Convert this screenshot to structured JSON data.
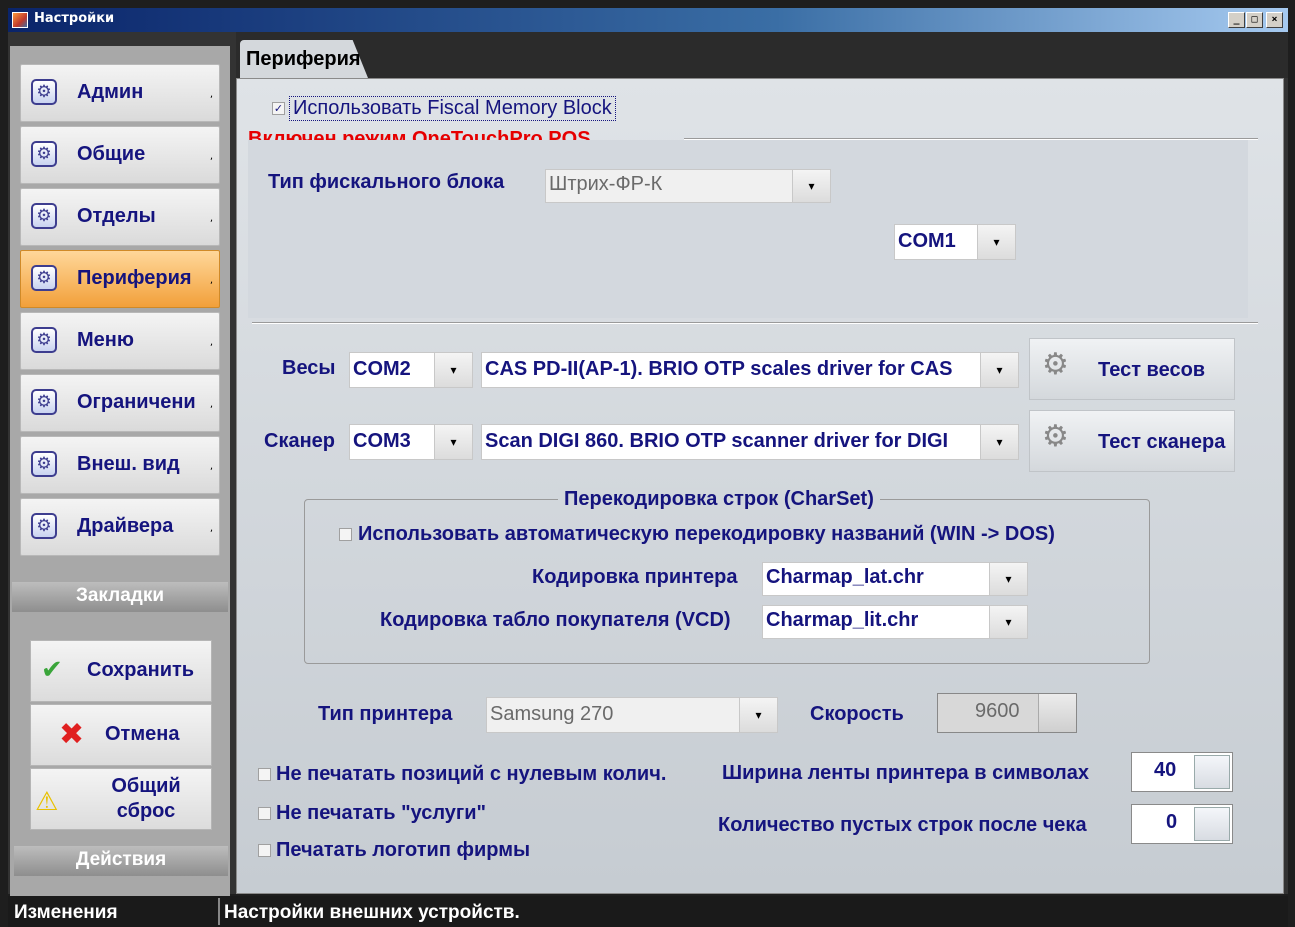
{
  "window": {
    "title": "Настройки",
    "min_glyph": "_",
    "max_glyph": "□",
    "close_glyph": "×"
  },
  "nav": {
    "items": [
      {
        "label": "Админ",
        "icon": "gear-icon"
      },
      {
        "label": "Общие",
        "icon": "gear-icon"
      },
      {
        "label": "Отделы",
        "icon": "gear-icon"
      },
      {
        "label": "Периферия",
        "icon": "gear-icon",
        "active": true
      },
      {
        "label": "Меню",
        "icon": "gear-icon"
      },
      {
        "label": "Ограничени",
        "icon": "gear-icon"
      },
      {
        "label": "Внеш. вид",
        "icon": "gear-icon"
      },
      {
        "label": "Драйвера",
        "icon": "gear-icon"
      }
    ],
    "section_label": "Закладки",
    "arrow": ","
  },
  "actions": {
    "save_label": "Сохранить",
    "cancel_label": "Отмена",
    "reset_label_1": "Общий",
    "reset_label_2": "сброс",
    "section_label": "Действия"
  },
  "tab": {
    "label": "Периферия"
  },
  "fiscal": {
    "use_fmb_label": "Использовать Fiscal Memory Block",
    "use_fmb_checked": true,
    "mode_notice": "Включен режим OneTouchPro POS",
    "type_label": "Тип фискального блока",
    "type_value": "Штрих-ФР-К",
    "port_value": "COM1"
  },
  "scales": {
    "label": "Весы",
    "port": "COM2",
    "driver": "CAS PD-II(AP-1). BRIO OTP scales driver for CAS",
    "test_label": "Тест весов"
  },
  "scanner": {
    "label": "Сканер",
    "port": "COM3",
    "driver": "Scan DIGI 860. BRIO OTP scanner driver for DIGI",
    "test_label": "Тест сканера"
  },
  "charset": {
    "group_title": "Перекодировка строк (CharSet)",
    "auto_label": "Использовать автоматическую перекодировку названий (WIN -> DOS)",
    "auto_checked": false,
    "printer_label": "Кодировка принтера",
    "printer_value": "Charmap_lat.chr",
    "vcd_label": "Кодировка табло покупателя (VCD)",
    "vcd_value": "Charmap_lit.chr"
  },
  "printer": {
    "type_label": "Тип принтера",
    "type_value": "Samsung 270",
    "speed_label": "Скорость",
    "speed_value": "9600",
    "width_label": "Ширина ленты принтера в символах",
    "width_value": "40",
    "blank_lines_label": "Количество пустых строк после чека",
    "blank_lines_value": "0"
  },
  "options": {
    "zero_qty_label": "Не печатать позиций с нулевым колич.",
    "services_label": "Не печатать \"услуги\"",
    "logo_label": "Печатать логотип фирмы"
  },
  "statusbar": {
    "left": "Изменения",
    "right": "Настройки внешних устройств."
  },
  "colors": {
    "label_blue": "#15147e",
    "notice_red": "#e60000",
    "active_nav": "#f2a03a"
  }
}
